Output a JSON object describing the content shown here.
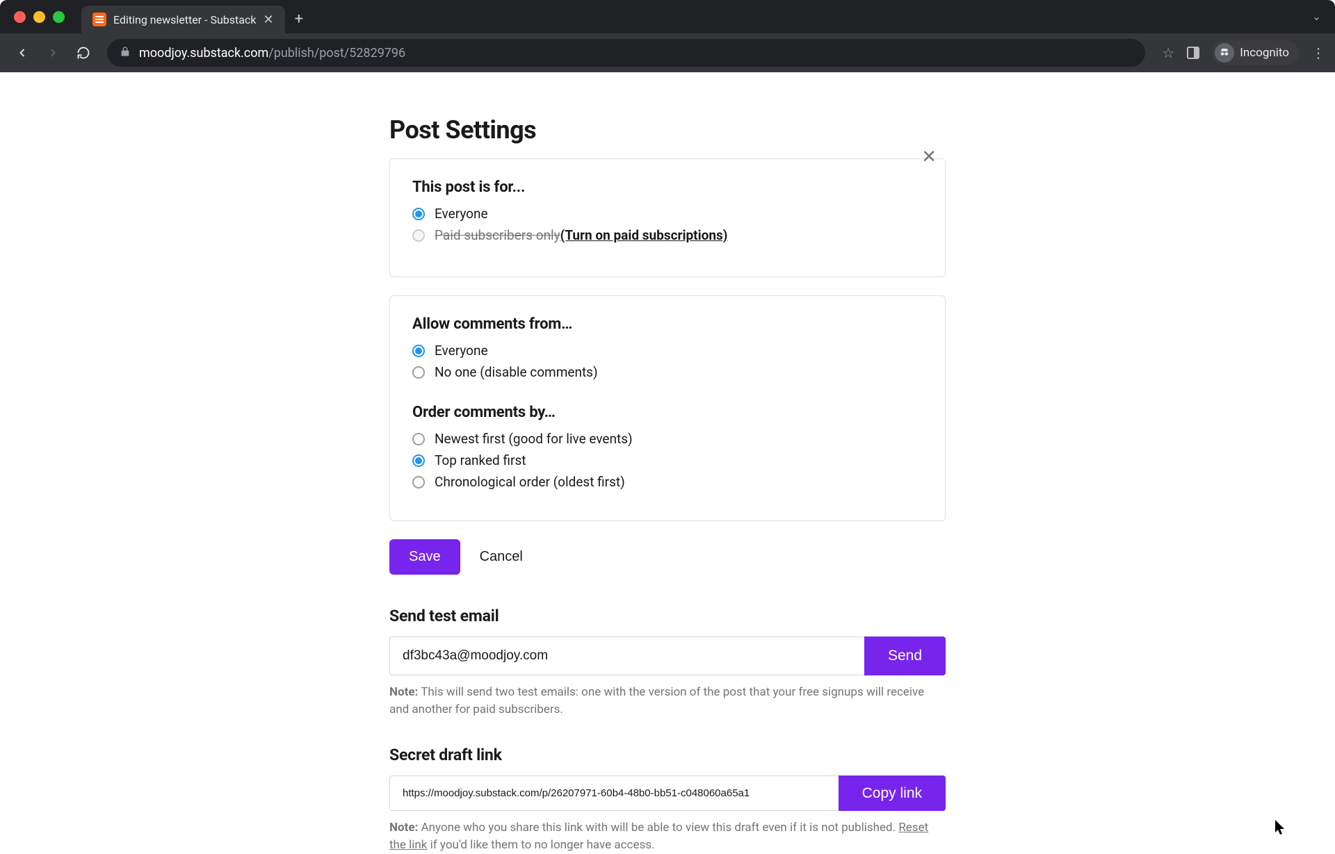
{
  "browser": {
    "tab_title": "Editing newsletter - Substack",
    "url_host": "moodjoy.substack.com",
    "url_path": "/publish/post/52829796",
    "incognito_label": "Incognito"
  },
  "page": {
    "title": "Post Settings",
    "audience": {
      "heading": "This post is for...",
      "options": [
        {
          "label": "Everyone",
          "checked": true,
          "disabled": false
        },
        {
          "label": "Paid subscribers only",
          "checked": false,
          "disabled": true,
          "link_text": "(Turn on paid subscriptions)"
        }
      ]
    },
    "comments_from": {
      "heading": "Allow comments from…",
      "options": [
        {
          "label": "Everyone",
          "checked": true
        },
        {
          "label": "No one (disable comments)",
          "checked": false
        }
      ]
    },
    "order_by": {
      "heading": "Order comments by…",
      "options": [
        {
          "label": "Newest first (good for live events)",
          "checked": false
        },
        {
          "label": "Top ranked first",
          "checked": true
        },
        {
          "label": "Chronological order (oldest first)",
          "checked": false
        }
      ]
    },
    "actions": {
      "save": "Save",
      "cancel": "Cancel"
    },
    "test_email": {
      "heading": "Send test email",
      "value": "df3bc43a@moodjoy.com",
      "button": "Send",
      "note_prefix": "Note:",
      "note_text": " This will send two test emails: one with the version of the post that your free signups will receive and another for paid subscribers."
    },
    "secret_link": {
      "heading": "Secret draft link",
      "value": "https://moodjoy.substack.com/p/26207971-60b4-48b0-bb51-c048060a65a1",
      "button": "Copy link",
      "note_prefix": "Note:",
      "note_text_1": " Anyone who you share this link with will be able to view this draft even if it is not published. ",
      "reset_link": "Reset the link",
      "note_text_2": " if you'd like them to no longer have access."
    }
  },
  "colors": {
    "accent": "#7724ec",
    "radio_active": "#2196f3"
  }
}
